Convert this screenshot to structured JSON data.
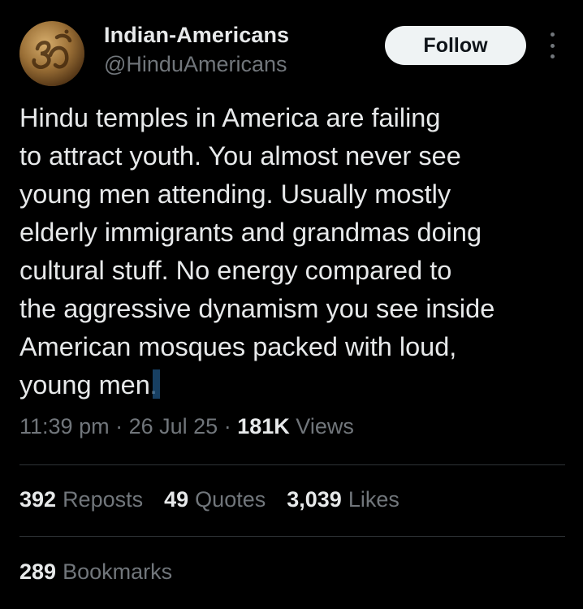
{
  "author": {
    "name": "Indian-Americans",
    "handle": "@HinduAmericans",
    "avatar_icon": "om-symbol-icon"
  },
  "actions": {
    "follow_label": "Follow",
    "more_icon": "more-vertical-icon"
  },
  "post": {
    "text": "Hindu temples in America are failing\nto attract youth. You almost never see\nyoung men attending. Usually mostly\nelderly immigrants and grandmas doing\ncultural stuff. No energy compared to\nthe aggressive dynamism you see inside\nAmerican mosques packed with loud,\nyoung men."
  },
  "meta": {
    "time": "11:39 pm",
    "separator": "·",
    "date": "26 Jul 25",
    "views_count": "181K",
    "views_label": "Views"
  },
  "stats": {
    "reposts_count": "392",
    "reposts_label": "Reposts",
    "quotes_count": "49",
    "quotes_label": "Quotes",
    "likes_count": "3,039",
    "likes_label": "Likes",
    "bookmarks_count": "289",
    "bookmarks_label": "Bookmarks"
  },
  "colors": {
    "background": "#000000",
    "primary_text": "#e7e9ea",
    "secondary_text": "#71767b",
    "divider": "#2f3336",
    "follow_button_bg": "#eff3f4",
    "follow_button_text": "#0f1419"
  }
}
